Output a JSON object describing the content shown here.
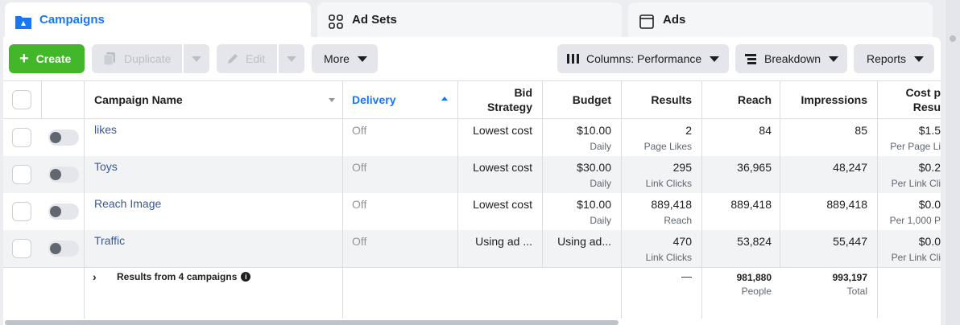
{
  "tabs": [
    {
      "label": "Campaigns"
    },
    {
      "label": "Ad Sets"
    },
    {
      "label": "Ads"
    }
  ],
  "toolbar": {
    "create_label": "Create",
    "duplicate_label": "Duplicate",
    "edit_label": "Edit",
    "more_label": "More",
    "columns_label": "Columns: Performance",
    "breakdown_label": "Breakdown",
    "reports_label": "Reports"
  },
  "table": {
    "headers": {
      "campaign_name": "Campaign Name",
      "delivery": "Delivery",
      "bid_strategy_1": "Bid",
      "bid_strategy_2": "Strategy",
      "budget": "Budget",
      "results": "Results",
      "reach": "Reach",
      "impressions": "Impressions",
      "cost_1": "Cost p",
      "cost_2": "Resu"
    },
    "rows": [
      {
        "name": "likes",
        "delivery": "Off",
        "bid": "Lowest cost",
        "budget": "$10.00",
        "budget_sub": "Daily",
        "results": "2",
        "results_sub": "Page Likes",
        "reach": "84",
        "impressions": "85",
        "cost": "$1.5",
        "cost_sub": "Per Page Li"
      },
      {
        "name": "Toys",
        "delivery": "Off",
        "bid": "Lowest cost",
        "budget": "$30.00",
        "budget_sub": "Daily",
        "results": "295",
        "results_sub": "Link Clicks",
        "reach": "36,965",
        "impressions": "48,247",
        "cost": "$0.2",
        "cost_sub": "Per Link Cli"
      },
      {
        "name": "Reach Image",
        "delivery": "Off",
        "bid": "Lowest cost",
        "budget": "$10.00",
        "budget_sub": "Daily",
        "results": "889,418",
        "results_sub": "Reach",
        "reach": "889,418",
        "impressions": "889,418",
        "cost": "$0.0",
        "cost_sub": "Per 1,000 P"
      },
      {
        "name": "Traffic",
        "delivery": "Off",
        "bid": "Using ad ...",
        "budget": "Using ad...",
        "budget_sub": "",
        "results": "470",
        "results_sub": "Link Clicks",
        "reach": "53,824",
        "impressions": "55,447",
        "cost": "$0.0",
        "cost_sub": "Per Link Cli"
      }
    ],
    "summary": {
      "label": "Results from 4 campaigns",
      "results": "—",
      "reach": "981,880",
      "reach_sub": "People",
      "impressions": "993,197",
      "impressions_sub": "Total"
    }
  },
  "colors": {
    "accent": "#1877f2",
    "create_green": "#42b72a",
    "link": "#385898"
  }
}
